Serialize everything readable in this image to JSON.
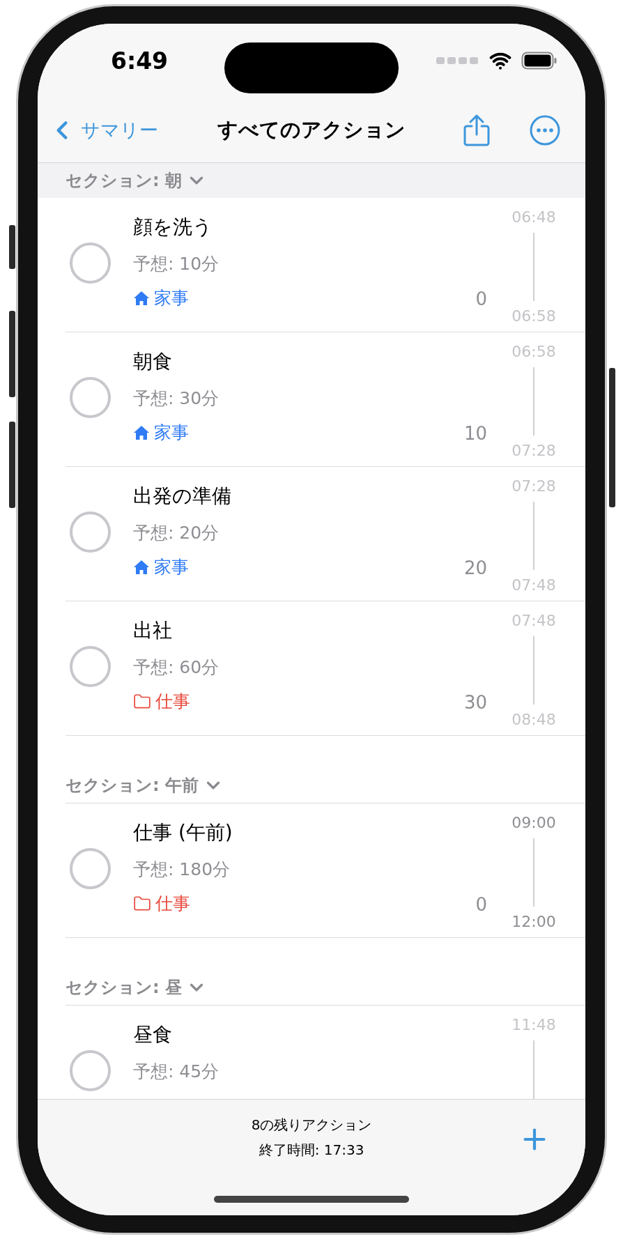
{
  "status_bar": {
    "time": "6:49"
  },
  "nav": {
    "back": "サマリー",
    "title": "すべてのアクション"
  },
  "sections": [
    {
      "title": "セクション: 朝",
      "rows": [
        {
          "title": "顔を洗う",
          "expected": "予想: 10分",
          "tag": {
            "kind": "home",
            "label": "家事"
          },
          "count": "0",
          "start": "06:48",
          "end": "06:58",
          "dim": true,
          "checked": false
        },
        {
          "title": "朝食",
          "expected": "予想: 30分",
          "tag": {
            "kind": "home",
            "label": "家事"
          },
          "count": "10",
          "start": "06:58",
          "end": "07:28",
          "dim": true,
          "checked": false
        },
        {
          "title": "出発の準備",
          "expected": "予想: 20分",
          "tag": {
            "kind": "home",
            "label": "家事"
          },
          "count": "20",
          "start": "07:28",
          "end": "07:48",
          "dim": true,
          "checked": false
        },
        {
          "title": "出社",
          "expected": "予想: 60分",
          "tag": {
            "kind": "work",
            "label": "仕事"
          },
          "count": "30",
          "start": "07:48",
          "end": "08:48",
          "dim": true,
          "checked": false
        }
      ]
    },
    {
      "title": "セクション: 午前",
      "rows": [
        {
          "title": "仕事 (午前)",
          "expected": "予想: 180分",
          "tag": {
            "kind": "work",
            "label": "仕事"
          },
          "count": "0",
          "start": "09:00",
          "end": "12:00",
          "dim": false,
          "checked": false
        }
      ]
    },
    {
      "title": "セクション: 昼",
      "rows": [
        {
          "title": "昼食",
          "expected": "予想: 45分",
          "start": "11:48",
          "dim": true,
          "checked": false
        }
      ]
    }
  ],
  "toolbar": {
    "remaining": "8の残りアクション",
    "end_time": "終了時間: 17:33"
  }
}
